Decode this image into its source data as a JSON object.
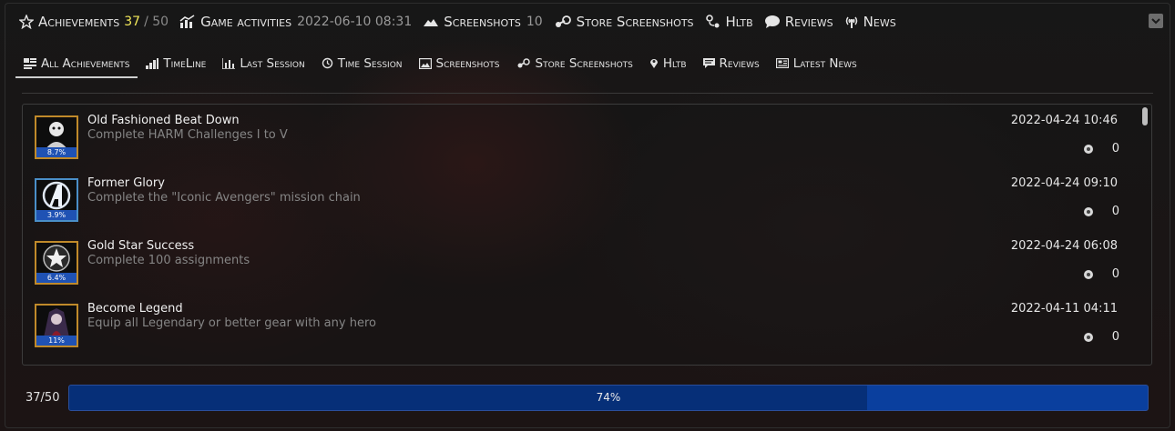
{
  "topbar": {
    "achievements_label": "Achievements",
    "achievements_unlocked": "37",
    "achievements_total": "/ 50",
    "activities_label": "Game activities",
    "activities_date": "2022-06-10 08:31",
    "screenshots_label": "Screenshots",
    "screenshots_count": "10",
    "store_screenshots_label": "Store Screenshots",
    "hltb_label": "Hltb",
    "reviews_label": "Reviews",
    "news_label": "News"
  },
  "tabs": [
    {
      "label": "All Achievements",
      "icon": "list-icon"
    },
    {
      "label": "TimeLine",
      "icon": "bar-chart-icon"
    },
    {
      "label": "Last Session",
      "icon": "stats-icon"
    },
    {
      "label": "Time Session",
      "icon": "history-icon"
    },
    {
      "label": "Screenshots",
      "icon": "image-icon"
    },
    {
      "label": "Store Screenshots",
      "icon": "steam-icon"
    },
    {
      "label": "Hltb",
      "icon": "pin-icon"
    },
    {
      "label": "Reviews",
      "icon": "comment-icon"
    },
    {
      "label": "Latest News",
      "icon": "newspaper-icon"
    }
  ],
  "achievements": [
    {
      "name": "Old Fashioned Beat Down",
      "description": "Complete HARM Challenges I to V",
      "date": "2022-04-24 10:46",
      "points": "0",
      "percent": "8.7%",
      "rarity_color": "#c08a2a"
    },
    {
      "name": "Former Glory",
      "description": "Complete the \"Iconic Avengers\" mission chain",
      "date": "2022-04-24 09:10",
      "points": "0",
      "percent": "3.9%",
      "rarity_color": "#4a8fc8"
    },
    {
      "name": "Gold Star Success",
      "description": "Complete 100 assignments",
      "date": "2022-04-24 06:08",
      "points": "0",
      "percent": "6.4%",
      "rarity_color": "#c08a2a"
    },
    {
      "name": "Become Legend",
      "description": "Equip all Legendary or better gear with any hero",
      "date": "2022-04-11 04:11",
      "points": "0",
      "percent": "11%",
      "rarity_color": "#c08a2a"
    }
  ],
  "progress": {
    "label": "37/50",
    "percent_text": "74%",
    "fraction": 0.74
  },
  "colors": {
    "accent_yellow": "#f2e85a",
    "progress_blue": "#0a3f9e",
    "percent_badge": "#1f52b4"
  }
}
